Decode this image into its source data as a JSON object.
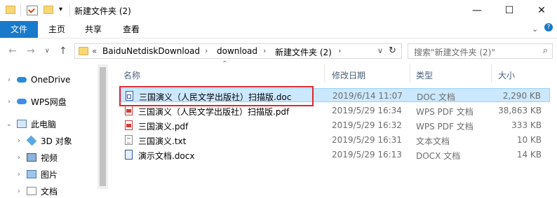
{
  "window": {
    "title": "新建文件夹 (2)"
  },
  "ribbon": {
    "tabs": [
      "文件",
      "主页",
      "共享",
      "查看"
    ]
  },
  "address": {
    "crumbs": [
      "BaiduNetdiskDownload",
      "download",
      "新建文件夹 (2)"
    ],
    "overflow": "«",
    "search_placeholder": "搜索\"新建文件夹 (2)\""
  },
  "nav": {
    "items": [
      {
        "label": "OneDrive",
        "icon": "cloud-icon"
      },
      {
        "label": "WPS网盘",
        "icon": "cloud-icon"
      },
      {
        "label": "此电脑",
        "icon": "computer-icon"
      },
      {
        "label": "3D 对象",
        "icon": "cube-icon"
      },
      {
        "label": "视频",
        "icon": "video-icon"
      },
      {
        "label": "图片",
        "icon": "image-icon"
      },
      {
        "label": "文档",
        "icon": "document-icon"
      }
    ]
  },
  "list": {
    "columns": {
      "name": "名称",
      "date": "修改日期",
      "type": "类型",
      "size": "大小"
    },
    "files": [
      {
        "name": "三国演义（人民文学出版社）扫描版.doc",
        "date": "2019/6/14 11:07",
        "type": "DOC 文档",
        "size": "2,290 KB",
        "icon": "doc-file-icon",
        "selected": true
      },
      {
        "name": "三国演义（人民文学出版社）扫描版.pdf",
        "date": "2019/5/29 16:34",
        "type": "WPS PDF 文档",
        "size": "38,863 KB",
        "icon": "pdf-file-icon"
      },
      {
        "name": "三国演义.pdf",
        "date": "2019/5/29 16:32",
        "type": "WPS PDF 文档",
        "size": "333 KB",
        "icon": "pdf-file-icon"
      },
      {
        "name": "三国演义.txt",
        "date": "2019/5/29 16:31",
        "type": "文本文档",
        "size": "10 KB",
        "icon": "txt-file-icon"
      },
      {
        "name": "演示文档.docx",
        "date": "2019/5/29 16:13",
        "type": "DOCX 文档",
        "size": "14 KB",
        "icon": "docx-file-icon"
      }
    ]
  },
  "colors": {
    "accent": "#1979ca",
    "selection": "#cce8ff",
    "highlight_box": "#e2262b"
  }
}
